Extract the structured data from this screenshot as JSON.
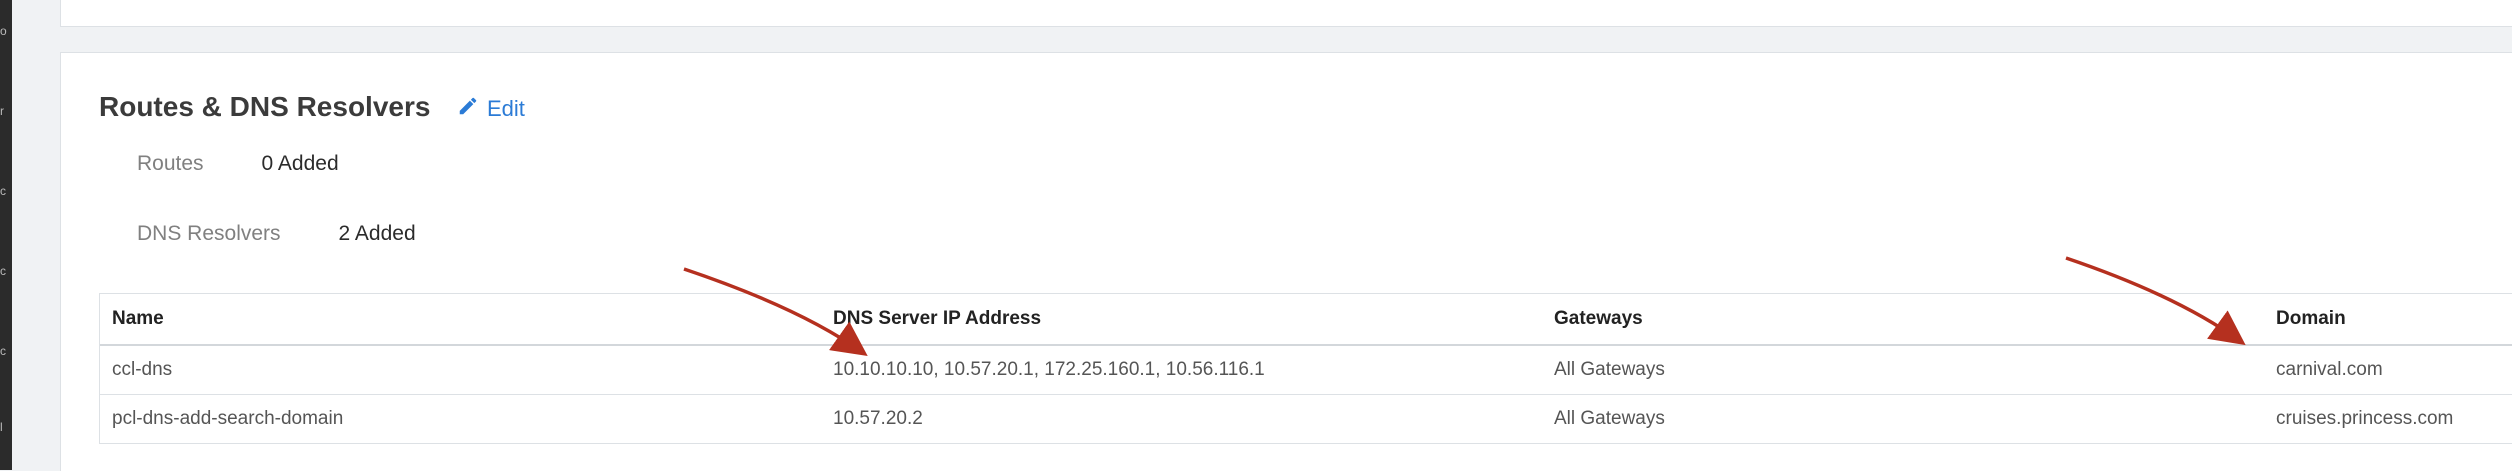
{
  "section": {
    "title": "Routes & DNS Resolvers",
    "edit_label": "Edit"
  },
  "summary": {
    "routes_label": "Routes",
    "routes_value": "0 Added",
    "dns_label": "DNS Resolvers",
    "dns_value": "2 Added"
  },
  "table": {
    "columns": [
      "Name",
      "DNS Server IP Address",
      "Gateways",
      "Domain"
    ],
    "rows": [
      [
        "ccl-dns",
        "10.10.10.10, 10.57.20.1, 172.25.160.1, 10.56.116.1",
        "All Gateways",
        "carnival.com"
      ],
      [
        "pcl-dns-add-search-domain",
        "10.57.20.2",
        "All Gateways",
        "cruises.princess.com"
      ]
    ]
  },
  "colors": {
    "accent": "#2b7bd6",
    "annotation_arrow": "#b5301f"
  },
  "icons": {
    "edit": "pencil-icon",
    "annotation": "arrow-icon"
  }
}
